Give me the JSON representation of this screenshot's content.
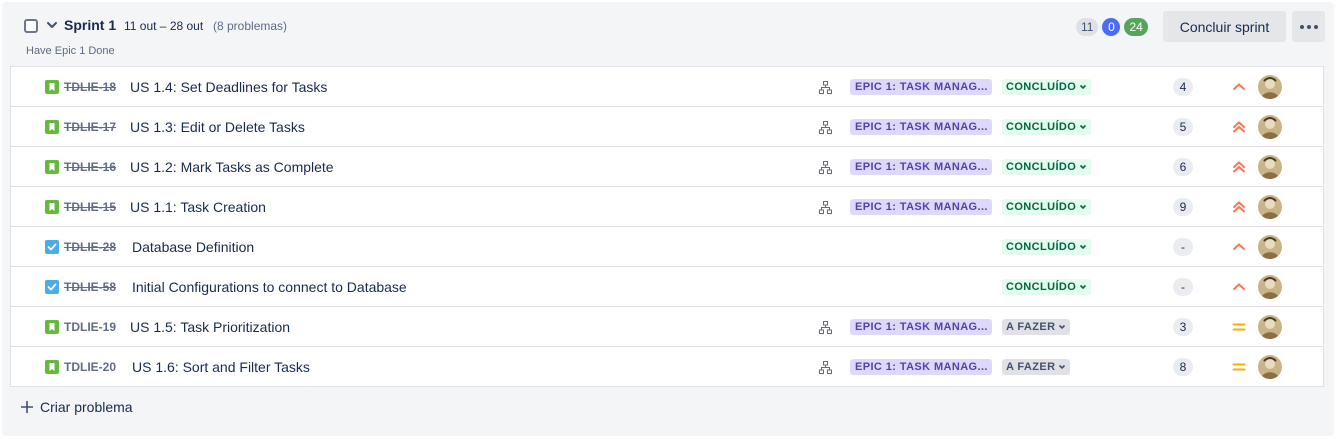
{
  "sprint": {
    "title": "Sprint 1",
    "dates": "11 out – 28 out",
    "issue_count": "(8 problemas)",
    "goal": "Have Epic 1 Done",
    "counts": {
      "todo": "11",
      "in_progress": "0",
      "done": "24"
    },
    "complete_label": "Concluir sprint"
  },
  "issues": [
    {
      "key": "TDLIE-18",
      "summary": "US 1.4: Set Deadlines for Tasks",
      "type": "story",
      "epic": "EPIC 1: TASK MANAG...",
      "status": "CONCLUÍDO",
      "points": "4",
      "priority": "medium",
      "done": true
    },
    {
      "key": "TDLIE-17",
      "summary": "US 1.3: Edit or Delete Tasks",
      "type": "story",
      "epic": "EPIC 1: TASK MANAG...",
      "status": "CONCLUÍDO",
      "points": "5",
      "priority": "high",
      "done": true
    },
    {
      "key": "TDLIE-16",
      "summary": "US 1.2: Mark Tasks as Complete",
      "type": "story",
      "epic": "EPIC 1: TASK MANAG...",
      "status": "CONCLUÍDO",
      "points": "6",
      "priority": "high",
      "done": true
    },
    {
      "key": "TDLIE-15",
      "summary": "US 1.1: Task Creation",
      "type": "story",
      "epic": "EPIC 1: TASK MANAG...",
      "status": "CONCLUÍDO",
      "points": "9",
      "priority": "high",
      "done": true
    },
    {
      "key": "TDLIE-28",
      "summary": "Database Definition",
      "type": "task",
      "epic": "",
      "status": "CONCLUÍDO",
      "points": "-",
      "priority": "medium",
      "done": true
    },
    {
      "key": "TDLIE-58",
      "summary": "Initial Configurations to connect to Database",
      "type": "task",
      "epic": "",
      "status": "CONCLUÍDO",
      "points": "-",
      "priority": "medium",
      "done": true
    },
    {
      "key": "TDLIE-19",
      "summary": "US 1.5: Task Prioritization",
      "type": "story",
      "epic": "EPIC 1: TASK MANAG...",
      "status": "A FAZER",
      "points": "3",
      "priority": "normal",
      "done": false
    },
    {
      "key": "TDLIE-20",
      "summary": "US 1.6: Sort and Filter Tasks",
      "type": "story",
      "epic": "EPIC 1: TASK MANAG...",
      "status": "A FAZER",
      "points": "8",
      "priority": "normal",
      "done": false
    }
  ],
  "create_label": "Criar problema",
  "colors": {
    "story": "#63ba3c",
    "task": "#4bade8",
    "epic_bg": "#dfd8fd",
    "epic_text": "#5243aa",
    "done_bg": "#e3fcef",
    "done_text": "#006644",
    "priority_orange": "#ff7452",
    "priority_yellow": "#ffab00"
  }
}
